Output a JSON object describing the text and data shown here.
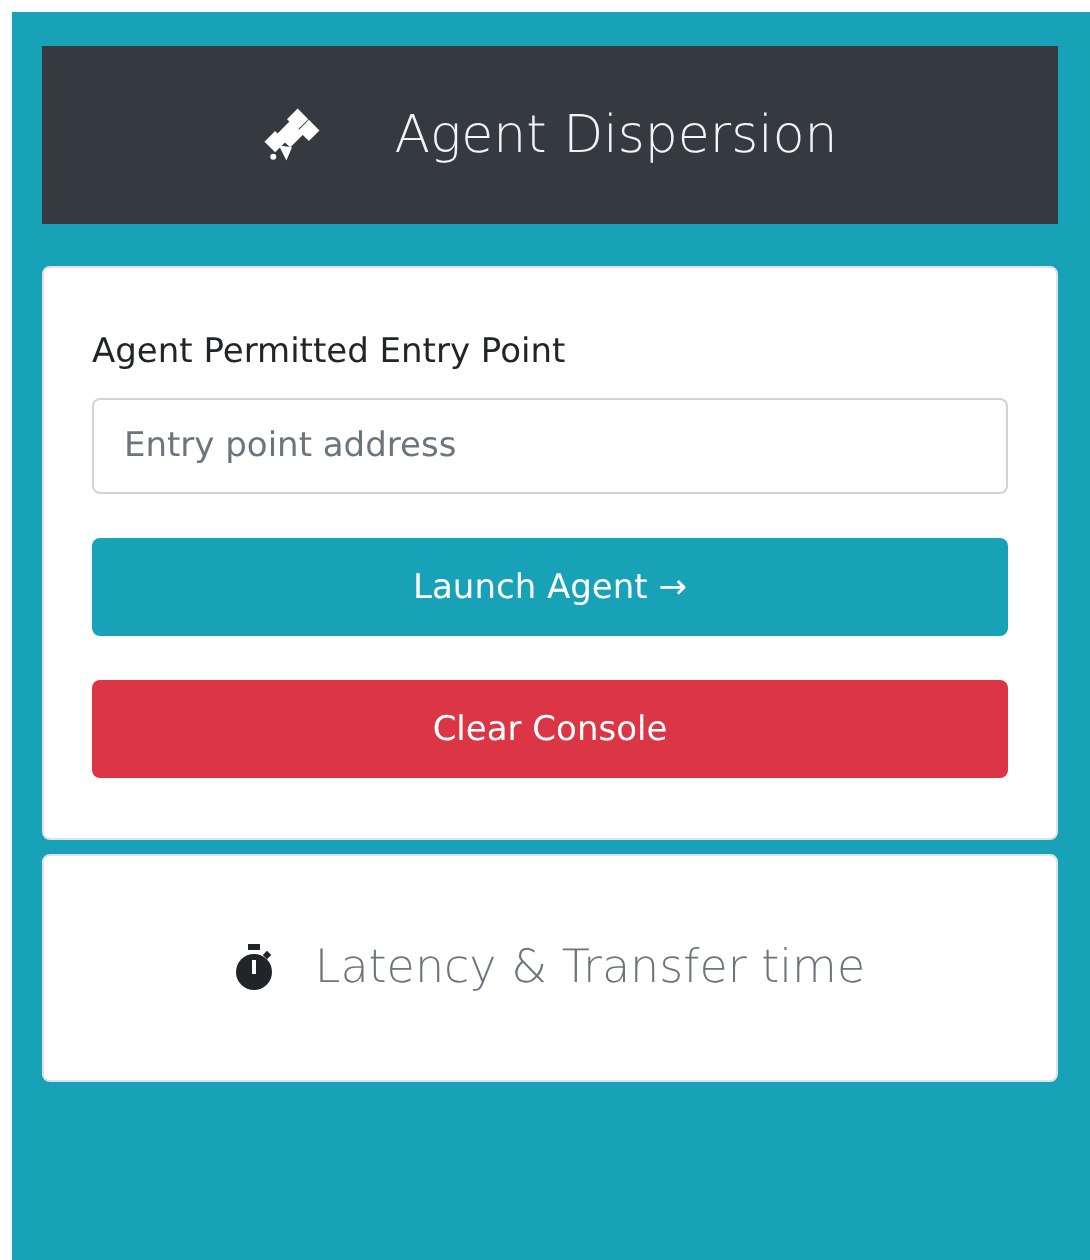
{
  "header": {
    "title": "Agent Dispersion"
  },
  "form": {
    "label": "Agent Permitted Entry Point",
    "field": {
      "placeholder": "Entry point address"
    },
    "buttons": [
      {
        "label": "Launch Agent →",
        "kind": "primary"
      },
      {
        "label": "Clear Console",
        "kind": "danger"
      }
    ]
  },
  "latency": {
    "title": "Latency & Transfer time"
  }
}
